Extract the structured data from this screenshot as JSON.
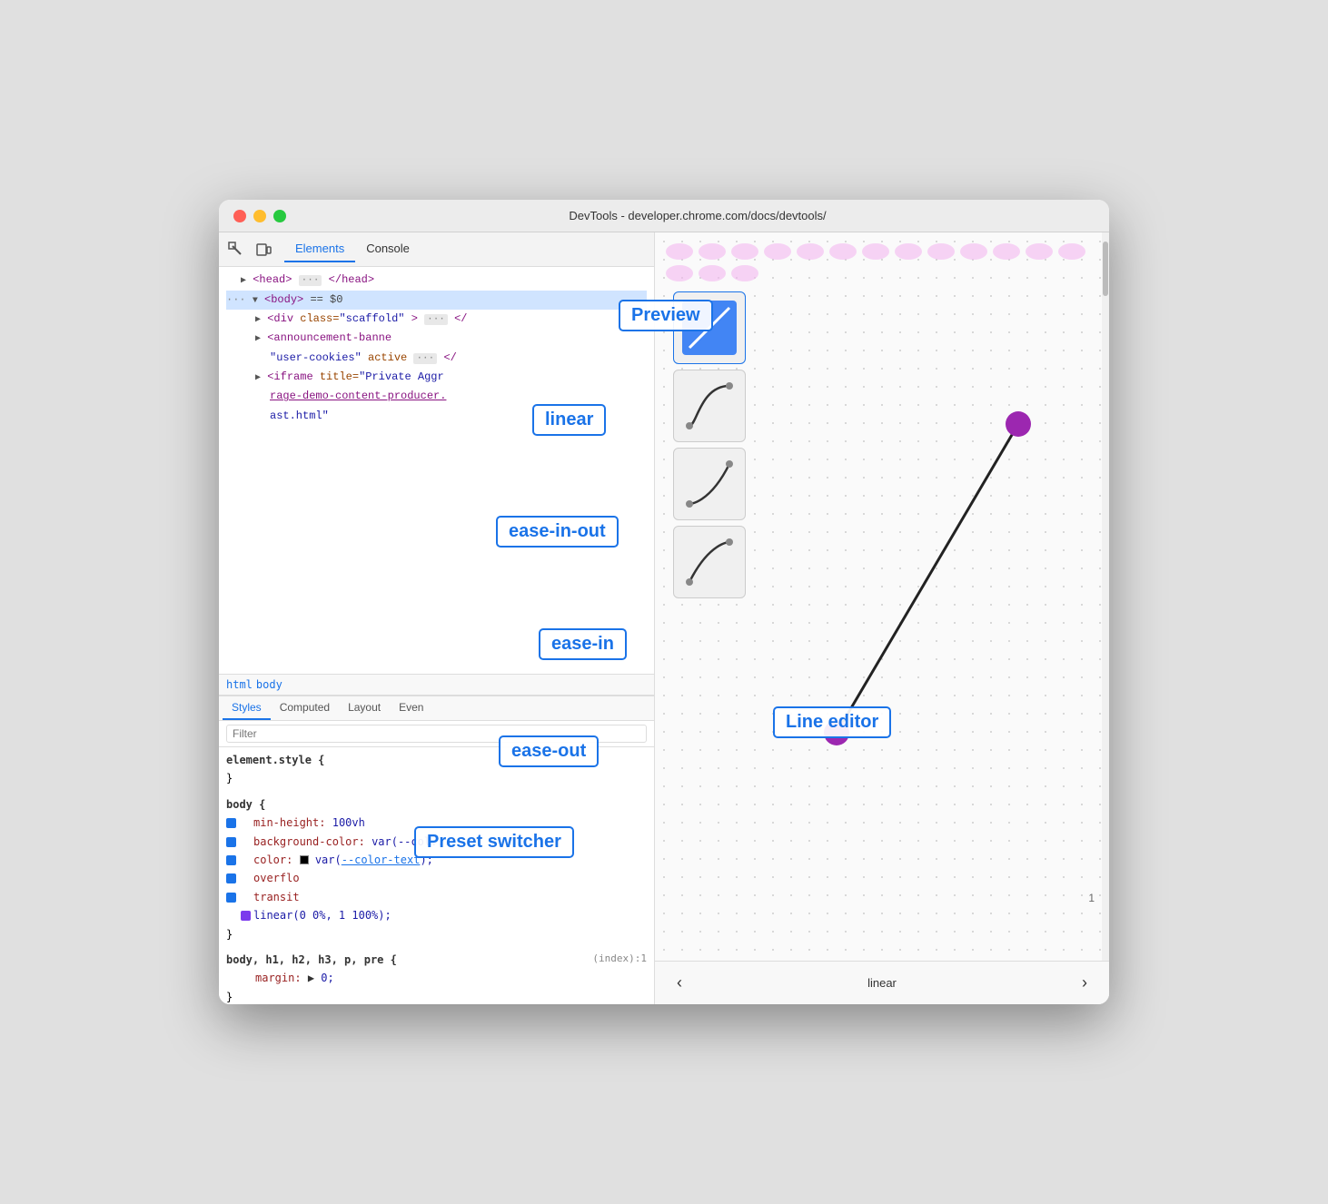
{
  "window": {
    "title": "DevTools - developer.chrome.com/docs/devtools/"
  },
  "toolbar": {
    "tabs": [
      "Elements",
      "Console"
    ],
    "active_tab": "Elements"
  },
  "dom_tree": {
    "lines": [
      {
        "text": "▶ <head> ··· </head>",
        "indent": 1
      },
      {
        "text": "··· ▼ <body> == $0",
        "indent": 0,
        "selected": true
      },
      {
        "text": "▶ <div class=\"scaffold\"> ··· </",
        "indent": 2
      },
      {
        "text": "▶ <announcement-banne",
        "indent": 2
      },
      {
        "text": "\"user-cookies\" active ··· </",
        "indent": 3
      },
      {
        "text": "▶ <iframe title=\"Private Aggr",
        "indent": 2
      },
      {
        "text": "rage-demo-content-producer.",
        "indent": 3
      },
      {
        "text": "ast.html\"",
        "indent": 3
      }
    ]
  },
  "breadcrumb": {
    "items": [
      "html",
      "body"
    ]
  },
  "styles_tabs": [
    "Styles",
    "Computed",
    "Layout",
    "Even"
  ],
  "filter_placeholder": "Filter",
  "css_rules": [
    {
      "selector": "element.style {",
      "close": "}",
      "props": []
    },
    {
      "selector": "body {",
      "close": "}",
      "props": [
        {
          "name": "min-height:",
          "value": "100vh",
          "checked": true
        },
        {
          "name": "background-color:",
          "value": "var(--col...",
          "checked": true
        },
        {
          "name": "color:",
          "value": "var(--color-text);",
          "checked": true,
          "swatch": true
        },
        {
          "name": "overflo",
          "value": "",
          "checked": true
        },
        {
          "name": "transit",
          "value": "",
          "checked": true
        },
        {
          "name": "linear(0 0%, 1 100%);",
          "value": "",
          "checked": true,
          "purple": true
        }
      ]
    },
    {
      "selector": "body, h1, h2, h3, p, pre {",
      "close": "}",
      "source": "(index):1",
      "props": [
        {
          "name": "margin:",
          "value": "▶ 0;",
          "checked": false
        }
      ]
    }
  ],
  "preview": {
    "preset_nav": {
      "prev": "‹",
      "next": "›",
      "current": "linear"
    },
    "presets": [
      {
        "name": "linear",
        "type": "linear"
      },
      {
        "name": "ease-in-out",
        "type": "ease-in-out"
      },
      {
        "name": "ease-in",
        "type": "ease-in"
      },
      {
        "name": "ease-out",
        "type": "ease-out"
      }
    ]
  },
  "annotations": {
    "preview_label": "Preview",
    "linear_label": "linear",
    "ease_in_out_label": "ease-in-out",
    "ease_in_label": "ease-in",
    "ease_out_label": "ease-out",
    "line_editor_label": "Line editor",
    "preset_switcher_label": "Preset switcher"
  }
}
